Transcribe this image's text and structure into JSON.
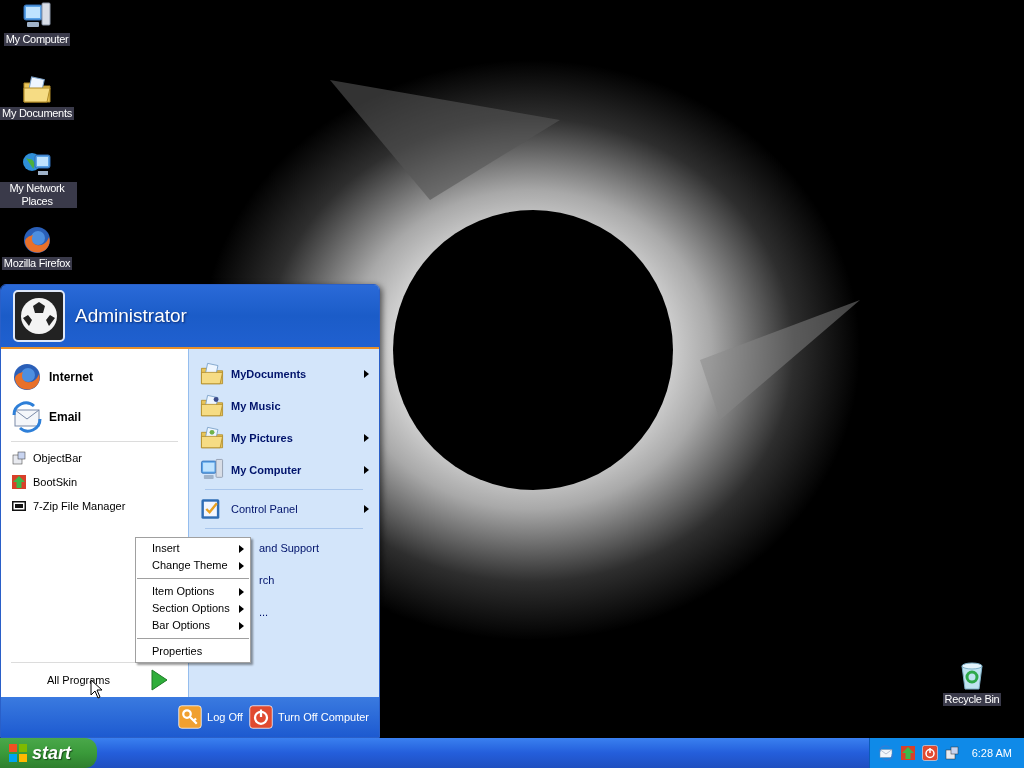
{
  "desktop_icons": [
    {
      "label": "My Computer",
      "kind": "computer"
    },
    {
      "label": "My Documents",
      "kind": "documents"
    },
    {
      "label": "My Network Places",
      "kind": "network"
    },
    {
      "label": "Mozilla Firefox",
      "kind": "firefox"
    },
    {
      "label": "Recycle Bin",
      "kind": "recycle"
    }
  ],
  "start_menu": {
    "user": "Administrator",
    "pinned": [
      {
        "label": "Internet",
        "kind": "firefox"
      },
      {
        "label": "Email",
        "kind": "email"
      }
    ],
    "recent": [
      {
        "label": "ObjectBar",
        "kind": "objectbar"
      },
      {
        "label": "BootSkin",
        "kind": "bootskin"
      },
      {
        "label": "7-Zip File Manager",
        "kind": "zip"
      }
    ],
    "all_programs": "All Programs",
    "places": [
      {
        "kind": "documents",
        "label": "MyDocuments",
        "bold": true,
        "submenu": true
      },
      {
        "kind": "music",
        "label": "My Music",
        "bold": true,
        "submenu": false
      },
      {
        "kind": "pictures",
        "label": "My Pictures",
        "bold": true,
        "submenu": true
      },
      {
        "kind": "computer",
        "label": "My Computer",
        "bold": true,
        "submenu": true
      },
      {
        "kind": "separator"
      },
      {
        "kind": "control",
        "label": "Control Panel",
        "bold": false,
        "submenu": true
      },
      {
        "kind": "separator"
      },
      {
        "kind": "partial",
        "label": "and Support",
        "bold": false,
        "submenu": false
      },
      {
        "kind": "partial",
        "label": "rch",
        "bold": false,
        "submenu": false
      },
      {
        "kind": "partial",
        "label": "...",
        "bold": false,
        "submenu": false
      }
    ],
    "footer": [
      {
        "label": "Log Off",
        "kind": "logoff"
      },
      {
        "label": "Turn Off Computer",
        "kind": "shutdown"
      }
    ]
  },
  "context_menu": [
    {
      "kind": "item",
      "label": "Insert",
      "submenu": true
    },
    {
      "kind": "item",
      "label": "Change Theme",
      "submenu": true
    },
    {
      "kind": "separator"
    },
    {
      "kind": "item",
      "label": "Item Options",
      "submenu": true
    },
    {
      "kind": "item",
      "label": "Section Options",
      "submenu": true
    },
    {
      "kind": "item",
      "label": "Bar Options",
      "submenu": true
    },
    {
      "kind": "separator"
    },
    {
      "kind": "item",
      "label": "Properties",
      "submenu": false
    }
  ],
  "taskbar": {
    "start": "start",
    "clock": "6:28 AM"
  }
}
